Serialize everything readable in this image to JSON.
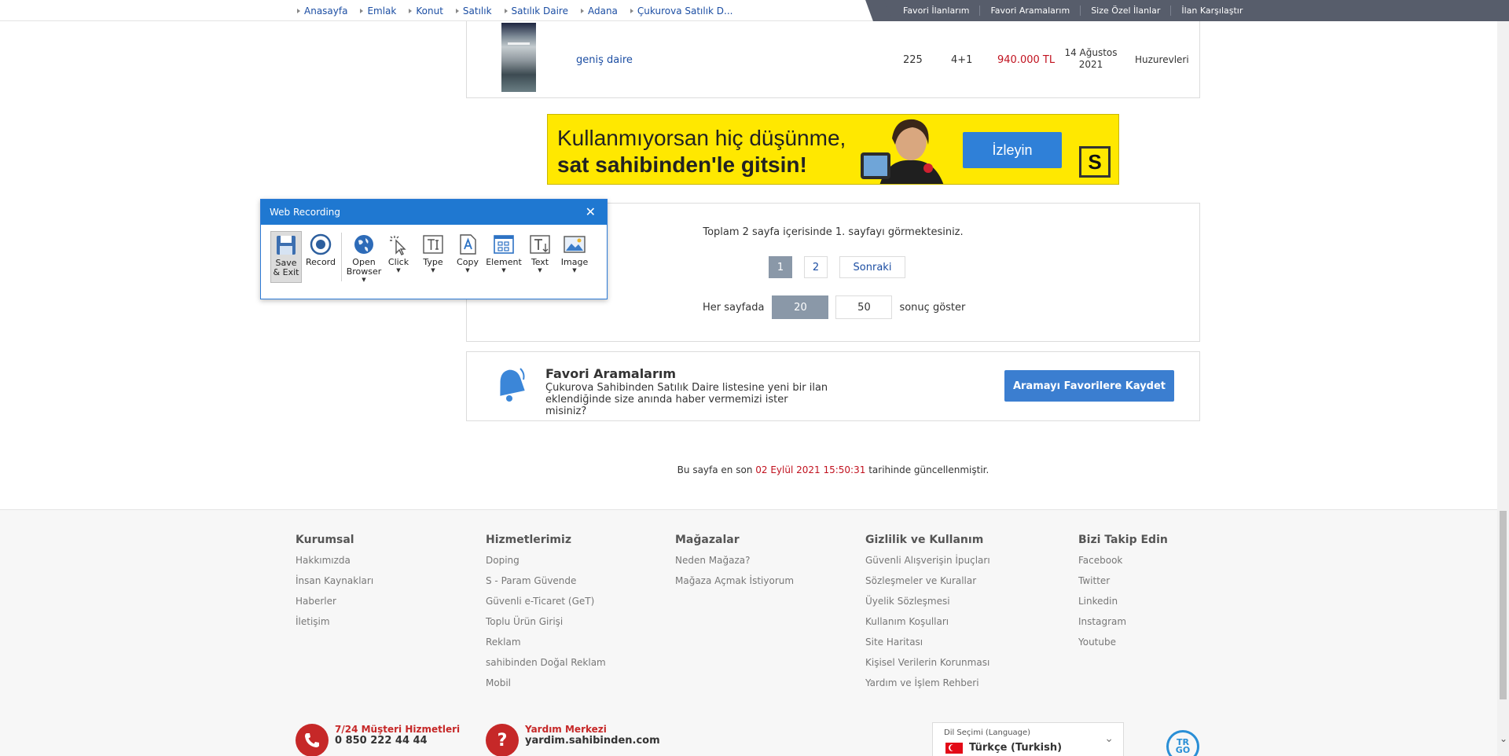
{
  "breadcrumb": [
    "Anasayfa",
    "Emlak",
    "Konut",
    "Satılık",
    "Satılık Daire",
    "Adana",
    "Çukurova Satılık D..."
  ],
  "top_links": [
    "Favori İlanlarım",
    "Favori Aramalarım",
    "Size Özel İlanlar",
    "İlan Karşılaştır"
  ],
  "listing": {
    "title": "geniş daire",
    "m2": "225",
    "rooms": "4+1",
    "price": "940.000 TL",
    "date_line1": "14 Ağustos",
    "date_line2": "2021",
    "location": "Huzurevleri"
  },
  "banner": {
    "line1": "Kullanmıyorsan hiç düşünme,",
    "line2": "sat sahibinden'le gitsin!",
    "button": "İzleyin",
    "logo": "S"
  },
  "pager": {
    "info": "Toplam 2 sayfa içerisinde 1. sayfayı görmektesiniz.",
    "pages": [
      "1",
      "2"
    ],
    "next": "Sonraki",
    "per_page_label": "Her sayfada",
    "per_page_options": [
      "20",
      "50"
    ],
    "per_page_suffix": "sonuç göster"
  },
  "favori": {
    "title": "Favori Aramalarım",
    "desc": "Çukurova Sahibinden Satılık Daire listesine yeni bir ilan eklendiğinde size anında haber vermemizi ister misiniz?",
    "button": "Aramayı Favorilere Kaydet"
  },
  "updated": {
    "prefix": "Bu sayfa en son",
    "date": "02 Eylül 2021 15:50:31",
    "suffix": "tarihinde güncellenmiştir."
  },
  "footer": {
    "columns": [
      {
        "title": "Kurumsal",
        "links": [
          "Hakkımızda",
          "İnsan Kaynakları",
          "Haberler",
          "İletişim"
        ]
      },
      {
        "title": "Hizmetlerimiz",
        "links": [
          "Doping",
          "S - Param Güvende",
          "Güvenli e-Ticaret (GeT)",
          "Toplu Ürün Girişi",
          "Reklam",
          "sahibinden Doğal Reklam",
          "Mobil"
        ]
      },
      {
        "title": "Mağazalar",
        "links": [
          "Neden Mağaza?",
          "Mağaza Açmak İstiyorum"
        ]
      },
      {
        "title": "Gizlilik ve Kullanım",
        "links": [
          "Güvenli Alışverişin İpuçları",
          "Sözleşmeler ve Kurallar",
          "Üyelik Sözleşmesi",
          "Kullanım Koşulları",
          "Site Haritası",
          "Kişisel Verilerin Korunması",
          "Yardım ve İşlem Rehberi"
        ]
      },
      {
        "title": "Bizi Takip Edin",
        "links": [
          "Facebook",
          "Twitter",
          "Linkedin",
          "Instagram",
          "Youtube"
        ]
      }
    ],
    "support": {
      "title": "7/24 Müşteri Hizmetleri",
      "value": "0 850 222 44 44"
    },
    "help": {
      "title": "Yardım Merkezi",
      "value": "yardim.sahibinden.com"
    },
    "language": {
      "label": "Dil Seçimi (Language)",
      "value": "Türkçe (Turkish)"
    },
    "trgo": "TR GO"
  },
  "web_recording": {
    "title": "Web Recording",
    "tools": [
      {
        "label": "Save & Exit",
        "icon": "floppy-icon"
      },
      {
        "label": "Record",
        "icon": "record-icon"
      },
      {
        "label": "Open Browser",
        "icon": "globe-icon"
      },
      {
        "label": "Click",
        "icon": "click-icon"
      },
      {
        "label": "Type",
        "icon": "type-icon"
      },
      {
        "label": "Copy",
        "icon": "copy-icon"
      },
      {
        "label": "Element",
        "icon": "element-icon"
      },
      {
        "label": "Text",
        "icon": "text-icon"
      },
      {
        "label": "Image",
        "icon": "image-icon"
      }
    ]
  }
}
